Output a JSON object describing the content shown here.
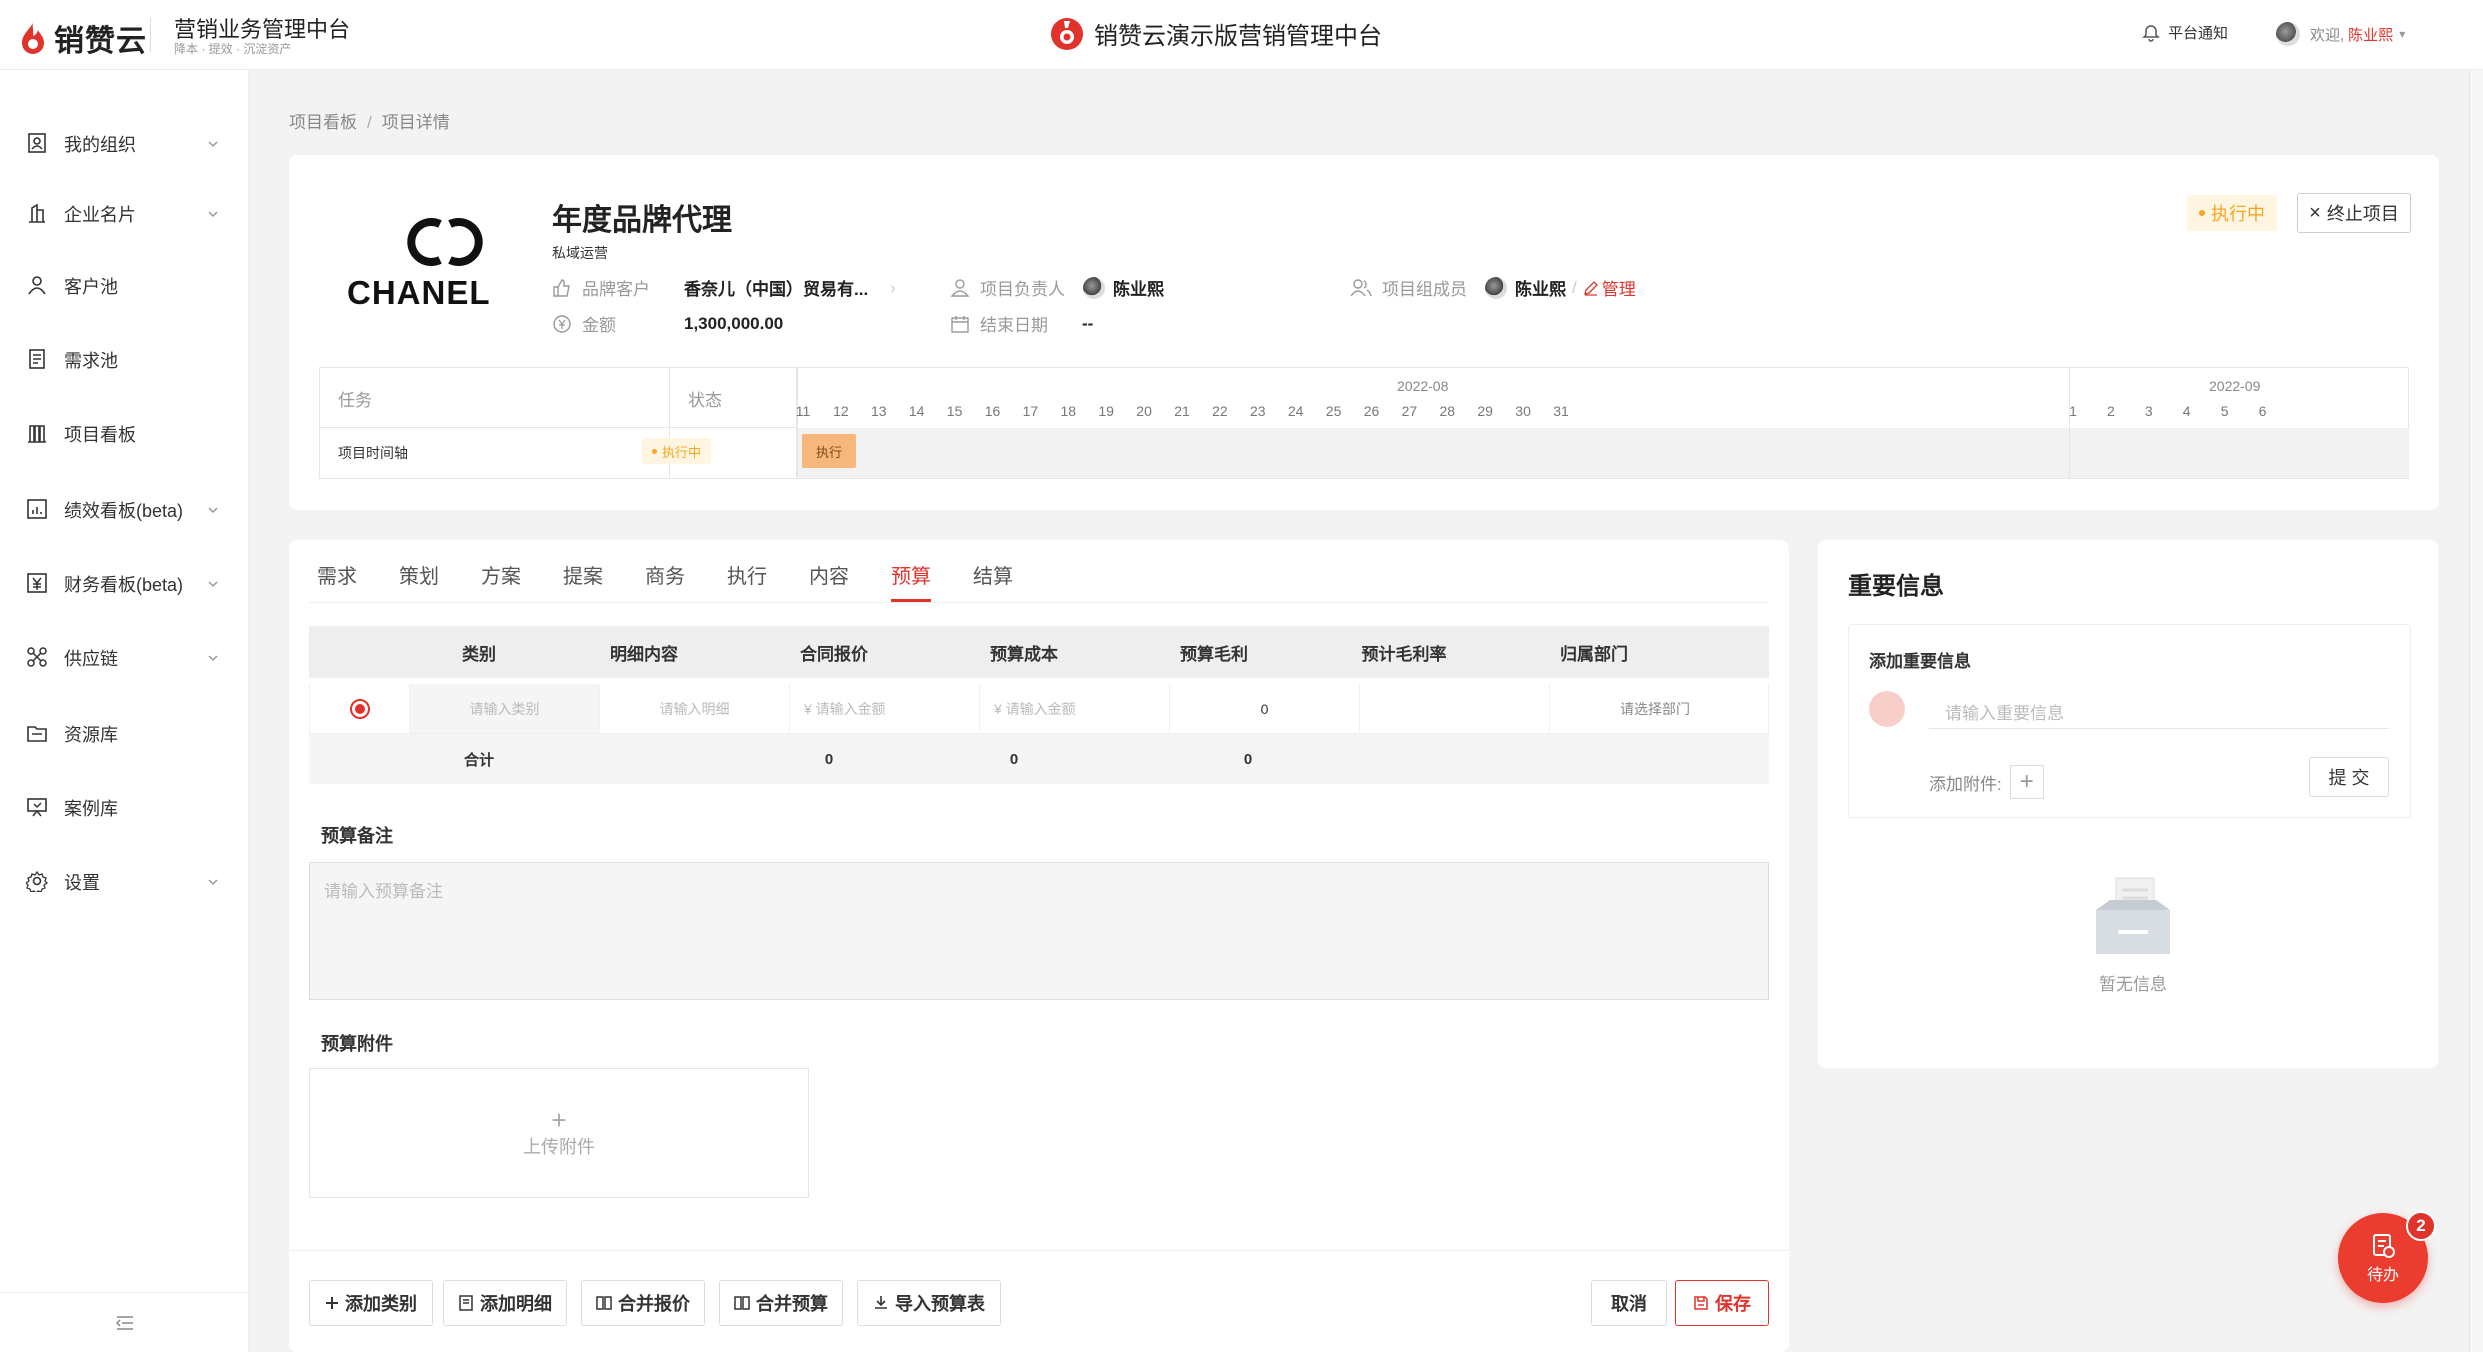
{
  "header": {
    "brand": "销赞云",
    "system_title": "营销业务管理中台",
    "system_sub": "降本 · 提效 · 沉淀资产",
    "center_title": "销赞云演示版营销管理中台",
    "notice": "平台通知",
    "welcome": "欢迎,",
    "user_name": "陈业熙"
  },
  "sidebar": {
    "items": [
      {
        "label": "我的组织",
        "icon": "org-icon",
        "expandable": true
      },
      {
        "label": "企业名片",
        "icon": "building-icon",
        "expandable": true
      },
      {
        "label": "客户池",
        "icon": "user-icon",
        "expandable": false
      },
      {
        "label": "需求池",
        "icon": "document-icon",
        "expandable": false
      },
      {
        "label": "项目看板",
        "icon": "board-icon",
        "expandable": false
      },
      {
        "label": "绩效看板(beta)",
        "icon": "chart-icon",
        "expandable": true
      },
      {
        "label": "财务看板(beta)",
        "icon": "yuan-icon",
        "expandable": true
      },
      {
        "label": "供应链",
        "icon": "network-icon",
        "expandable": true
      },
      {
        "label": "资源库",
        "icon": "folder-icon",
        "expandable": false
      },
      {
        "label": "案例库",
        "icon": "monitor-icon",
        "expandable": false
      },
      {
        "label": "设置",
        "icon": "gear-icon",
        "expandable": true
      }
    ]
  },
  "breadcrumb": {
    "items": [
      "项目看板",
      "项目详情"
    ],
    "sep": "/"
  },
  "project": {
    "title": "年度品牌代理",
    "tag": "私域运营",
    "brand_logo_text": "CHANEL",
    "status": "执行中",
    "end_button": "终止项目",
    "brand_customer_label": "品牌客户",
    "brand_customer_value": "香奈儿（中国）贸易有...",
    "amount_label": "金额",
    "amount_value": "1,300,000.00",
    "leader_label": "项目负责人",
    "leader_value": "陈业熙",
    "end_date_label": "结束日期",
    "end_date_value": "--",
    "members_label": "项目组成员",
    "members_value": "陈业熙",
    "manage_label": "管理"
  },
  "gantt": {
    "col_task": "任务",
    "col_status": "状态",
    "row_task": "项目时间轴",
    "row_status": "执行中",
    "bar_label": "执行",
    "month1": "2022-08",
    "month2": "2022-09",
    "days1": [
      "11",
      "12",
      "13",
      "14",
      "15",
      "16",
      "17",
      "18",
      "19",
      "20",
      "21",
      "22",
      "23",
      "24",
      "25",
      "26",
      "27",
      "28",
      "29",
      "30",
      "31"
    ],
    "days2": [
      "1",
      "2",
      "3",
      "4",
      "5",
      "6"
    ]
  },
  "tabs": [
    {
      "label": "需求",
      "active": false
    },
    {
      "label": "策划",
      "active": false
    },
    {
      "label": "方案",
      "active": false
    },
    {
      "label": "提案",
      "active": false
    },
    {
      "label": "商务",
      "active": false
    },
    {
      "label": "执行",
      "active": false
    },
    {
      "label": "内容",
      "active": false
    },
    {
      "label": "预算",
      "active": true
    },
    {
      "label": "结算",
      "active": false
    }
  ],
  "budget": {
    "headers": [
      "类别",
      "明细内容",
      "合同报价",
      "预算成本",
      "预算毛利",
      "预计毛利率",
      "归属部门"
    ],
    "row": {
      "category_placeholder": "请输入类别",
      "detail_placeholder": "请输入明细",
      "quote_placeholder": "¥  请输入金额",
      "cost_placeholder": "¥  请输入金额",
      "profit": "0",
      "rate": "",
      "dept_placeholder": "请选择部门"
    },
    "sum": {
      "label": "合计",
      "quote": "0",
      "cost": "0",
      "profit": "0"
    },
    "remark_label": "预算备注",
    "remark_placeholder": "请输入预算备注",
    "attach_label": "预算附件",
    "upload_label": "上传附件"
  },
  "actions": {
    "add_category": "添加类别",
    "add_detail": "添加明细",
    "merge_quote": "合并报价",
    "merge_budget": "合并预算",
    "import_budget": "导入预算表",
    "cancel": "取消",
    "save": "保存"
  },
  "important": {
    "title": "重要信息",
    "add_title": "添加重要信息",
    "input_placeholder": "请输入重要信息",
    "attach_label": "添加附件:",
    "submit": "提 交",
    "empty_text": "暂无信息"
  },
  "todo": {
    "label": "待办",
    "count": "2"
  },
  "colors": {
    "accent": "#e0332c",
    "status": "#f5a623",
    "gantt_bar": "#f8b77a"
  }
}
